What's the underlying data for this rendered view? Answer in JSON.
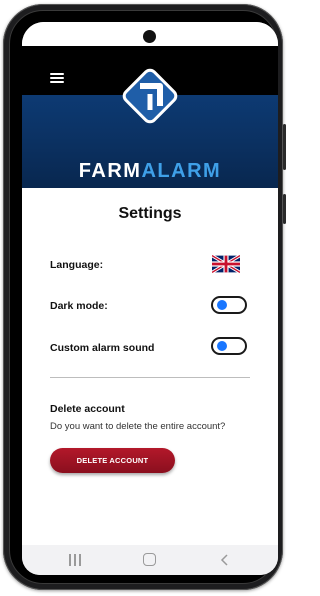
{
  "app": {
    "brand_part1": "FARM",
    "brand_part2": "ALARM",
    "colors": {
      "header": "#000000",
      "banner": "#0b3060",
      "brand_accent": "#3fa0e8",
      "toggle_knob": "#1976ff",
      "delete_button": "#a11425"
    }
  },
  "header": {
    "menu_icon": "hamburger-menu-icon",
    "logo_icon": "farmalarm-logo-icon"
  },
  "settings": {
    "title": "Settings",
    "language": {
      "label": "Language:",
      "value_icon": "uk-flag-icon"
    },
    "dark_mode": {
      "label": "Dark mode:",
      "enabled": false
    },
    "custom_alarm_sound": {
      "label": "Custom alarm sound",
      "enabled": false
    }
  },
  "delete_account": {
    "title": "Delete account",
    "question": "Do you want to delete the entire account?",
    "button_label": "DELETE ACCOUNT"
  },
  "navbar": {
    "icons": [
      "recents-icon",
      "home-icon",
      "back-icon"
    ]
  }
}
